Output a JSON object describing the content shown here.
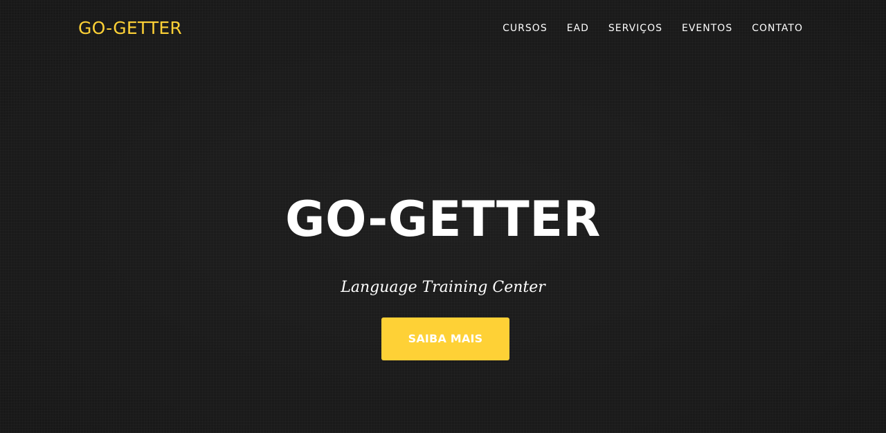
{
  "navbar": {
    "brand": "GO-GETTER",
    "items": [
      {
        "label": "CURSOS"
      },
      {
        "label": "EAD"
      },
      {
        "label": "SERVIÇOS"
      },
      {
        "label": "EVENTOS"
      },
      {
        "label": "CONTATO"
      }
    ]
  },
  "hero": {
    "title": "GO-GETTER",
    "subtitle": "Language Training Center",
    "cta_label": "SAIBA MAIS"
  },
  "colors": {
    "accent": "#fed136",
    "background": "#1b1b1b",
    "text": "#ffffff"
  }
}
